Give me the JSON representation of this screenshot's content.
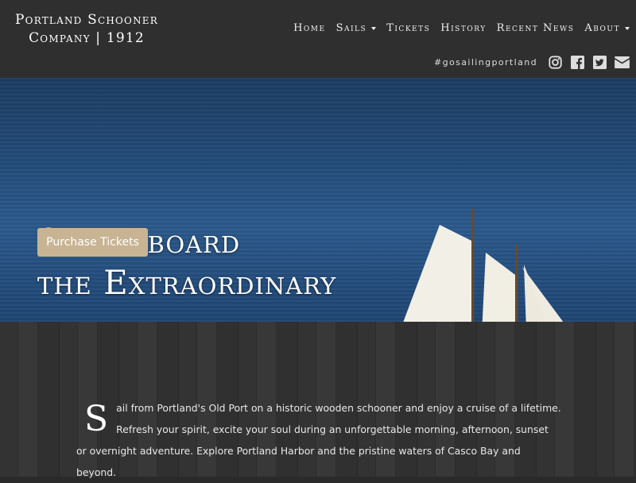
{
  "brand": {
    "line1": "Portland Schooner",
    "line2": "Company | 1912"
  },
  "nav": {
    "items": [
      {
        "label": "Home",
        "dropdown": false
      },
      {
        "label": "Sails",
        "dropdown": true
      },
      {
        "label": "Tickets",
        "dropdown": false
      },
      {
        "label": "History",
        "dropdown": false
      },
      {
        "label": "Recent News",
        "dropdown": false
      },
      {
        "label": "About",
        "dropdown": true
      }
    ]
  },
  "social": {
    "hashtag": "#gosailingportland",
    "icons": [
      "instagram-icon",
      "facebook-icon",
      "twitter-icon",
      "email-icon"
    ]
  },
  "hero": {
    "title_line1": "Step Aboard",
    "title_line2": "the Extraordinary",
    "cta_label": "Purchase Tickets"
  },
  "intro": {
    "dropcap": "S",
    "text": "ail from Portland's Old Port on a historic wooden schooner and enjoy a cruise of a lifetime. Refresh your spirit, excite your soul during an unforgettable morning, afternoon, sunset or overnight adventure. Explore Portland Harbor and the pristine waters of Casco Bay and beyond."
  },
  "colors": {
    "header_bg": "#2f2f30",
    "cta_bg": "#c8b493",
    "text": "#ffffff"
  }
}
